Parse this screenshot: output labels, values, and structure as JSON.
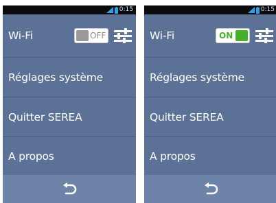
{
  "screens": [
    {
      "status_time": "0:15",
      "menu": {
        "wifi_label": "Wi-Fi",
        "wifi_toggle_text": "OFF",
        "wifi_state": "off",
        "system_settings_label": "Réglages système",
        "quit_label": "Quitter SEREA",
        "about_label": "A propos"
      }
    },
    {
      "status_time": "0:15",
      "menu": {
        "wifi_label": "Wi-Fi",
        "wifi_toggle_text": "ON",
        "wifi_state": "on",
        "system_settings_label": "Réglages système",
        "quit_label": "Quitter SEREA",
        "about_label": "A propos"
      }
    }
  ],
  "colors": {
    "background": "#5b7296",
    "bottom_bar": "#6d84a8",
    "status_bar": "#0b0b0b",
    "status_icons": "#2aa4e8",
    "toggle_on": "#44b02c",
    "toggle_off_knob": "#9a9a9a"
  },
  "icons": {
    "signal": "signal-icon",
    "battery": "battery-icon",
    "settings": "sliders-icon",
    "back": "back-arrow-icon"
  }
}
